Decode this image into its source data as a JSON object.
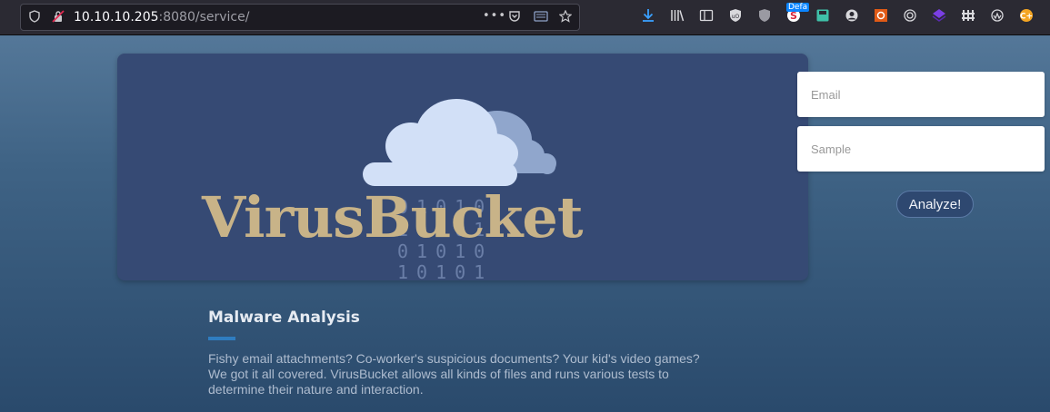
{
  "browser": {
    "url_host": "10.10.10.205",
    "url_rest": ":8080/service/",
    "extension_badge": "Defa",
    "toolbar_icons": [
      "shield-icon",
      "insecure-lock-icon",
      "more-icon",
      "pocket-icon",
      "reader-icon",
      "bookmark-star-icon",
      "download-icon",
      "library-icon",
      "sidebar-icon",
      "extension-icons"
    ]
  },
  "hero": {
    "logo_text": "VirusBucket",
    "binary_lines": [
      "01010",
      "10101",
      "01010",
      "10101"
    ]
  },
  "form": {
    "email_placeholder": "Email",
    "sample_placeholder": "Sample",
    "submit_label": "Analyze!"
  },
  "section": {
    "title": "Malware Analysis",
    "body": "Fishy email attachments? Co-worker's suspicious documents? Your kid's video games? We got it all covered. VirusBucket allows all kinds of files and runs various tests to determine their nature and interaction."
  },
  "colors": {
    "accent": "#2f7dc0",
    "logo_gold": "#c8b388",
    "card_bg": "#364a74"
  }
}
